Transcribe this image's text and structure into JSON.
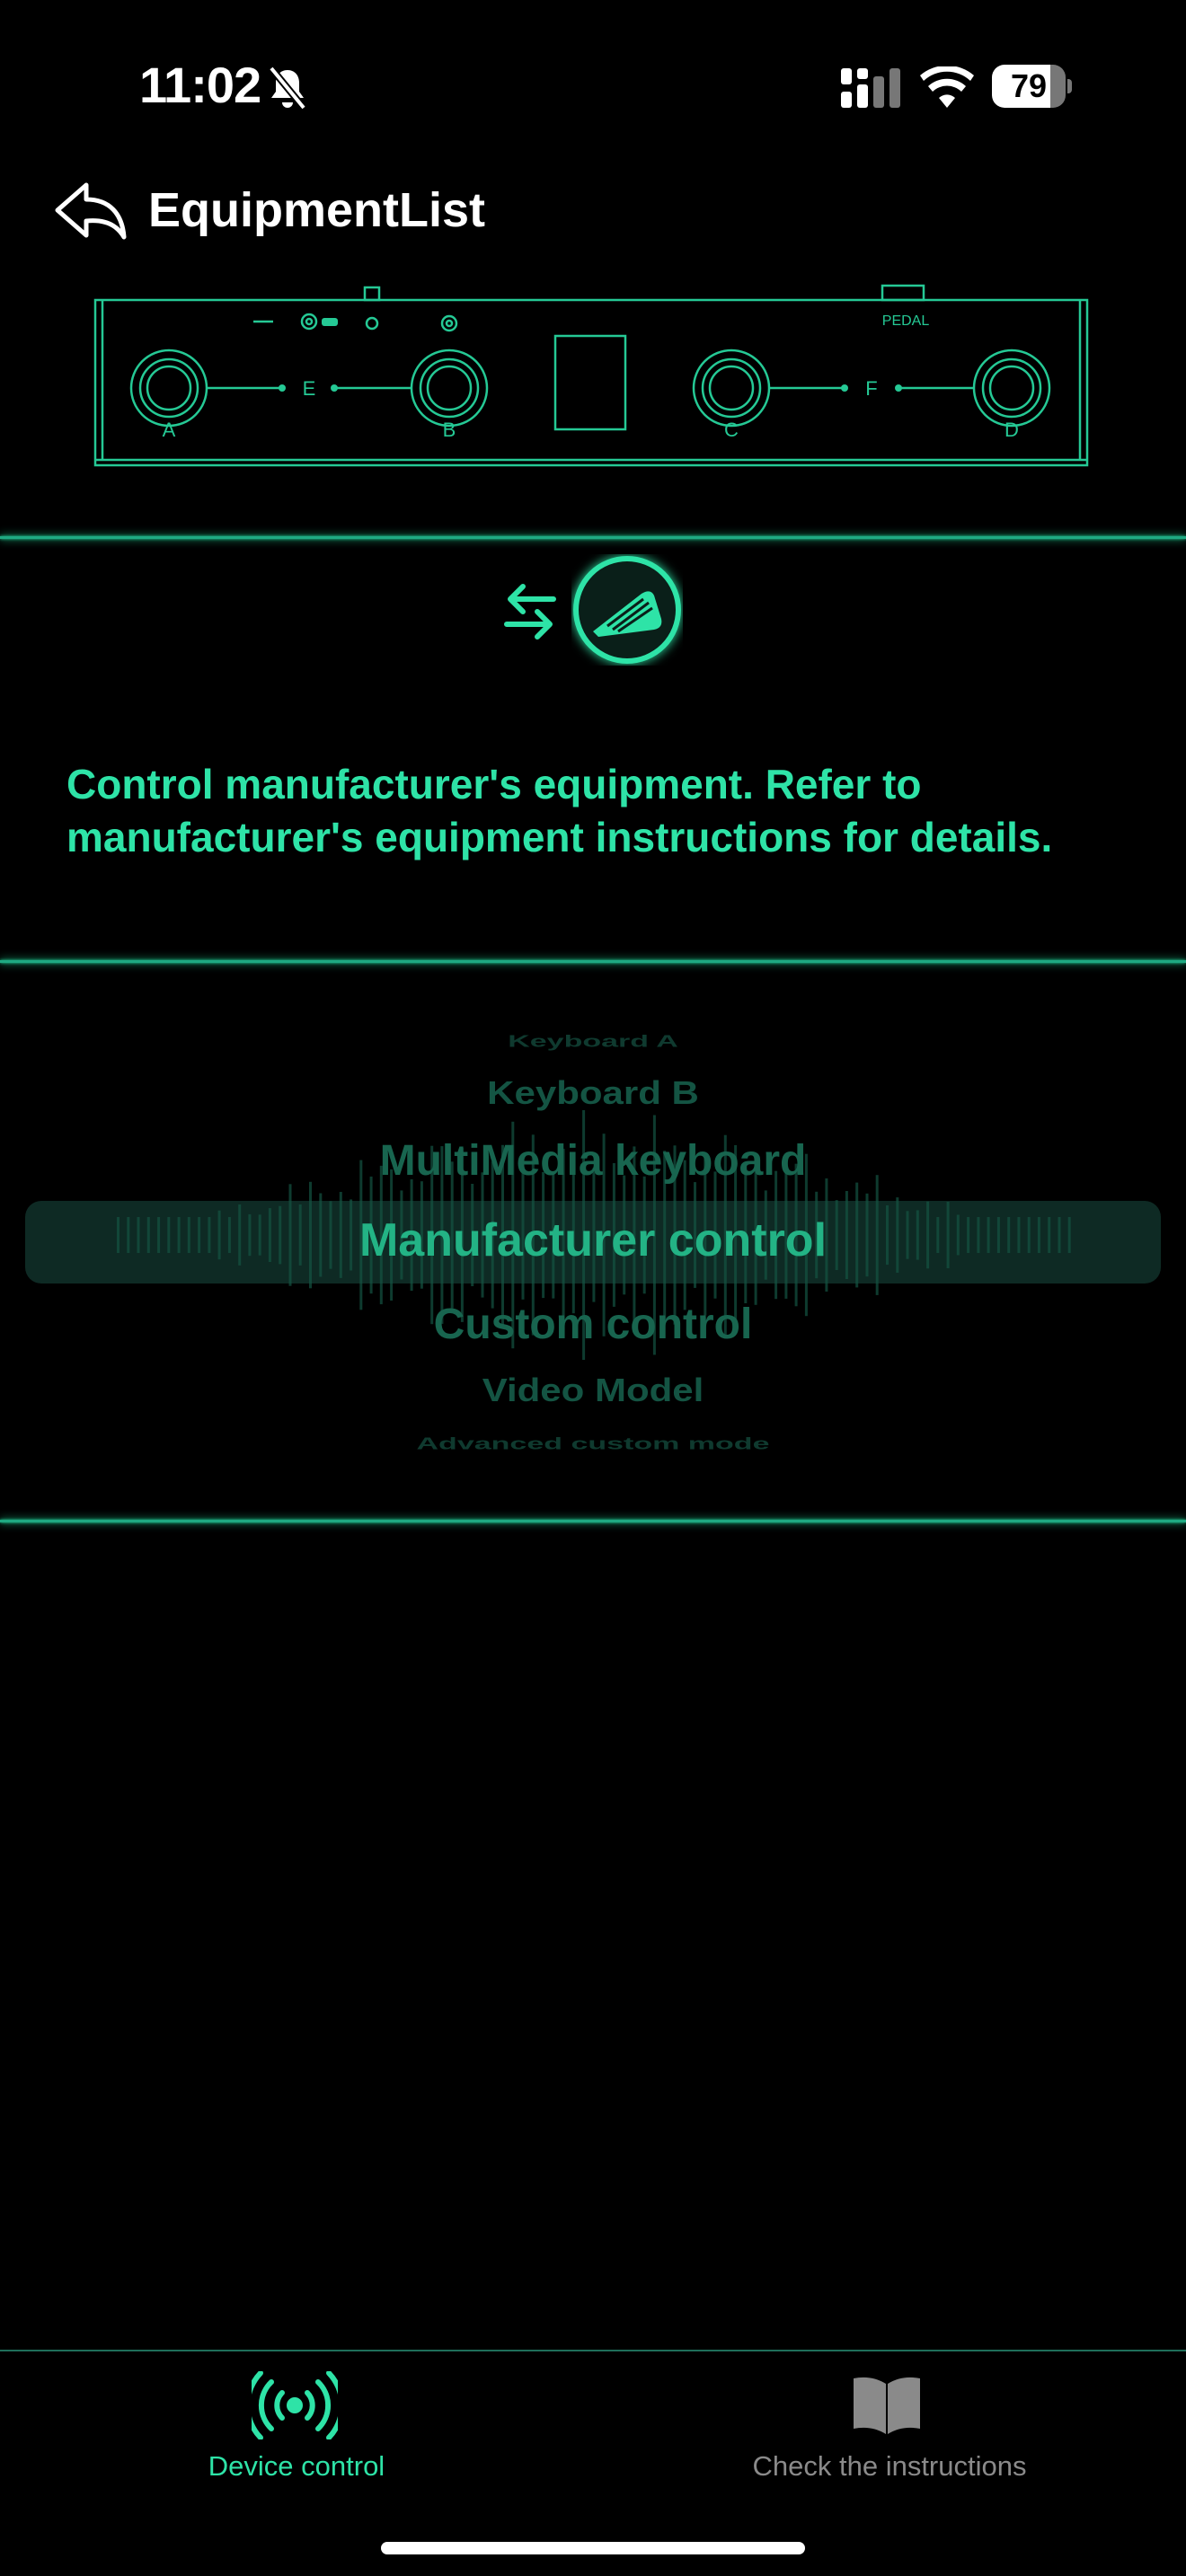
{
  "status_bar": {
    "time": "11:02",
    "battery_level": "79",
    "battery_fraction": 0.79
  },
  "header": {
    "title": "EquipmentList",
    "back_icon": "reply-arrow-icon"
  },
  "device_diagram": {
    "pedal_label": "PEDAL",
    "switch_labels": [
      "A",
      "B",
      "C",
      "D"
    ],
    "link_labels": [
      "E",
      "F"
    ]
  },
  "mode_icons": {
    "swap": "swap-arrows-icon",
    "mode": "expression-pedal-icon"
  },
  "description": "Control manufacturer's equipment. Refer to manufacturer's equipment instructions for details.",
  "picker": {
    "items": [
      "Keyboard A",
      "Keyboard B",
      "MultiMedia keyboard",
      "Manufacturer control",
      "Custom control",
      "Video Model",
      "Advanced custom mode"
    ],
    "selected": "Manufacturer control"
  },
  "tabbar": {
    "tabs": [
      {
        "label": "Device control",
        "icon": "broadcast-icon",
        "active": true
      },
      {
        "label": "Check the instructions",
        "icon": "book-icon",
        "active": false
      }
    ]
  },
  "colors": {
    "accent": "#2ee3a7",
    "accent_dim": "#1fa982",
    "background": "#000000",
    "inactive": "#8a8a8a"
  }
}
